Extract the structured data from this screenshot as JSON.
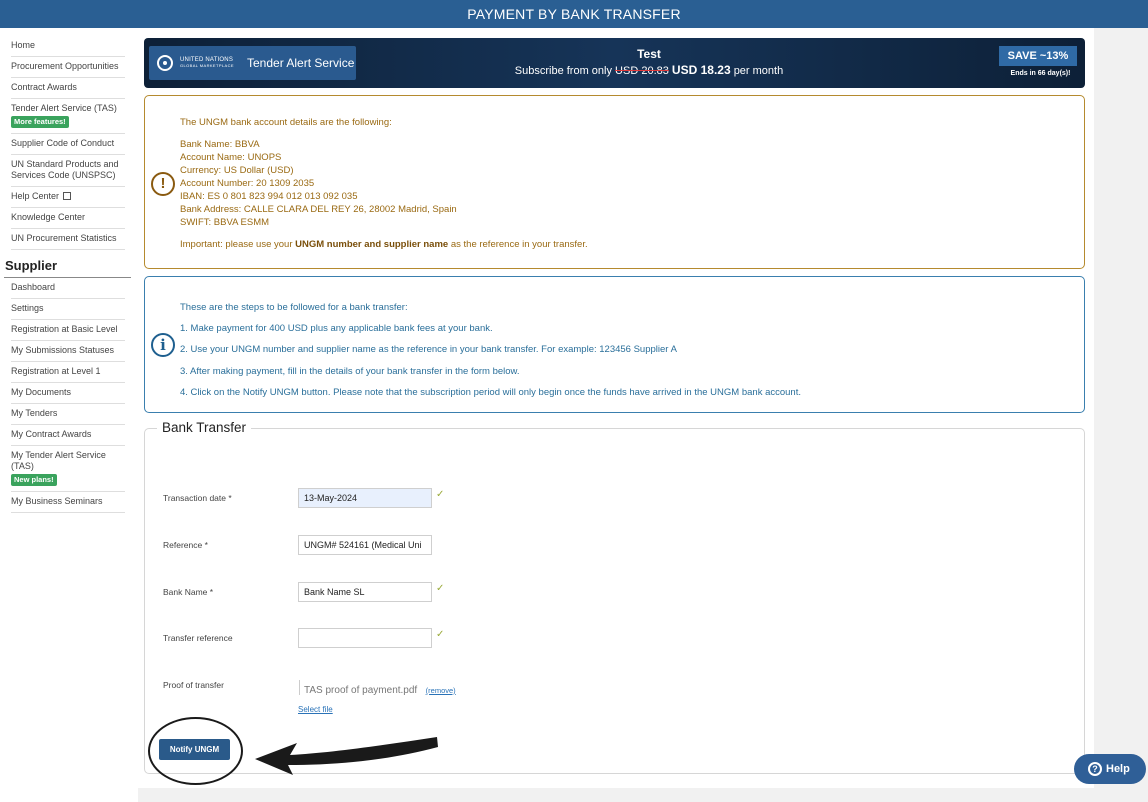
{
  "header": {
    "title": "PAYMENT BY BANK TRANSFER"
  },
  "sidebar": {
    "items": [
      {
        "label": "Home"
      },
      {
        "label": "Procurement Opportunities"
      },
      {
        "label": "Contract Awards"
      },
      {
        "label": "Tender Alert Service (TAS)",
        "badge": "More features!"
      },
      {
        "label": "Supplier Code of Conduct"
      },
      {
        "label": "UN Standard Products and Services Code (UNSPSC)"
      },
      {
        "label": "Help Center"
      },
      {
        "label": "Knowledge Center"
      },
      {
        "label": "UN Procurement Statistics"
      }
    ],
    "supplier_heading": "Supplier",
    "supplier_items": [
      {
        "label": "Dashboard"
      },
      {
        "label": "Settings"
      },
      {
        "label": "Registration at Basic Level"
      },
      {
        "label": "My Submissions Statuses"
      },
      {
        "label": "Registration at Level 1"
      },
      {
        "label": "My Documents"
      },
      {
        "label": "My Tenders"
      },
      {
        "label": "My Contract Awards"
      },
      {
        "label": "My Tender Alert Service (TAS)",
        "badge": "New plans!"
      },
      {
        "label": "My Business Seminars"
      }
    ]
  },
  "banner": {
    "logo_line1": "UNITED NATIONS",
    "logo_line2": "GLOBAL MARKETPLACE",
    "service_name": "Tender Alert Service",
    "title": "Test",
    "subscribe_prefix": "Subscribe from only",
    "old_price": "USD 20.83",
    "new_price": "USD 18.23",
    "per": "per month",
    "save": "SAVE ~13%",
    "ends": "Ends in 66 day(s)!"
  },
  "bank_info": {
    "intro": "The UNGM bank account details are the following:",
    "lines": [
      "Bank Name: BBVA",
      "Account Name: UNOPS",
      "Currency: US Dollar (USD)",
      "Account Number: 20 1309 2035",
      "IBAN: ES 0 801 823 994 012 013 092 035",
      "Bank Address: CALLE CLARA DEL REY 26, 28002 Madrid, Spain",
      "SWIFT: BBVA ESMM"
    ],
    "important_prefix": "Important: please use your",
    "important_bold": "UNGM number and supplier name",
    "important_suffix": "as the reference in your transfer."
  },
  "steps": {
    "intro": "These are the steps to be followed for a bank transfer:",
    "items": [
      "1. Make payment for 400 USD plus any applicable bank fees at your bank.",
      "2. Use your UNGM number and supplier name as the reference in your bank transfer. For example: 123456 Supplier A",
      "3. After making payment, fill in the details of your bank transfer in the form below.",
      "4. Click on the Notify UNGM button. Please note that the subscription period will only begin once the funds have arrived in the UNGM bank account."
    ]
  },
  "form": {
    "legend": "Bank Transfer",
    "transaction_date_label": "Transaction date *",
    "transaction_date_value": "13-May-2024",
    "reference_label": "Reference *",
    "reference_value": "UNGM# 524161 (Medical Uni",
    "bank_name_label": "Bank Name *",
    "bank_name_value": "Bank Name SL",
    "transfer_reference_label": "Transfer reference",
    "transfer_reference_value": "",
    "proof_label": "Proof of transfer",
    "file_name": "TAS proof of payment.pdf",
    "remove_label": "(remove)",
    "select_file_label": "Select file",
    "check_mark": "✓",
    "notify_label": "Notify UNGM"
  },
  "help": {
    "label": "Help",
    "icon_glyph": "?"
  }
}
